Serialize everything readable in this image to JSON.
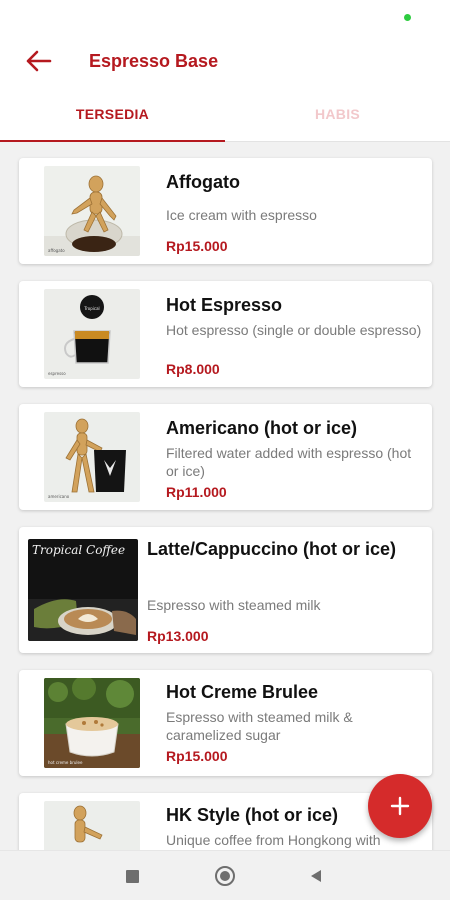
{
  "app": {
    "title": "Espresso Base"
  },
  "tabs": [
    {
      "label": "TERSEDIA"
    },
    {
      "label": "HABIS"
    }
  ],
  "products": [
    {
      "name": "Affogato",
      "description": "Ice cream with espresso",
      "price": "Rp15.000"
    },
    {
      "name": "Hot Espresso",
      "description": "Hot espresso (single or double espresso)",
      "price": "Rp8.000"
    },
    {
      "name": "Americano (hot or ice)",
      "description": "Filtered water added with espresso (hot or ice)",
      "price": "Rp11.000"
    },
    {
      "name": "Latte/Cappuccino (hot or ice)",
      "description": "Espresso with steamed milk",
      "price": "Rp13.000",
      "image_caption": "Tropical Coffee"
    },
    {
      "name": "Hot Creme Brulee",
      "description": "Espresso with steamed milk & caramelized sugar",
      "price": "Rp15.000"
    },
    {
      "name": "HK Style (hot or ice)",
      "description": "Unique coffee from Hongkong with",
      "price": ""
    }
  ],
  "colors": {
    "accent": "#b5191f",
    "fab": "#d52b2b",
    "tab_inactive": "#f2c8cb",
    "status_dot": "#2ecc40"
  },
  "icons": {
    "back": "arrow-left-icon",
    "fab": "plus-icon",
    "nav": [
      "square-recents-icon",
      "circle-home-icon",
      "triangle-back-icon"
    ]
  }
}
